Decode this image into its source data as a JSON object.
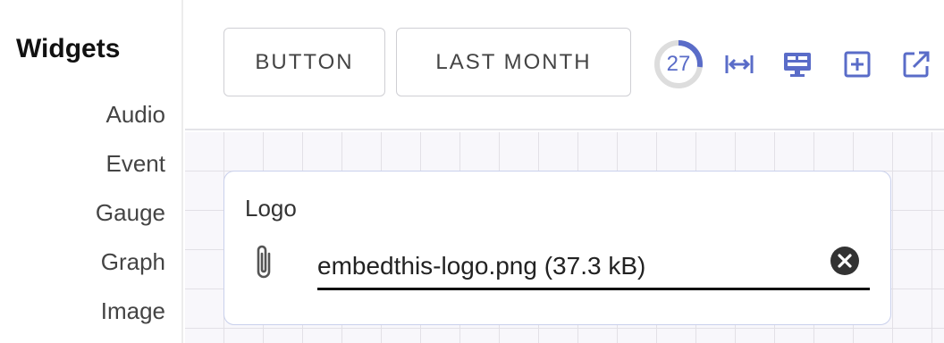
{
  "sidebar": {
    "title": "Widgets",
    "items": [
      {
        "label": "Audio"
      },
      {
        "label": "Event"
      },
      {
        "label": "Gauge"
      },
      {
        "label": "Graph"
      },
      {
        "label": "Image"
      }
    ]
  },
  "toolbar": {
    "button_label": "BUTTON",
    "range_label": "LAST MONTH",
    "gauge": {
      "value": "27",
      "fraction": 0.27
    },
    "icons": [
      "fit-width-icon",
      "display-icon",
      "add-box-icon",
      "open-external-icon"
    ]
  },
  "widget": {
    "label": "Logo",
    "file_value": "embedthis-logo.png (37.3 kB)",
    "icon": "paperclip-icon",
    "clear_icon": "clear-icon"
  },
  "colors": {
    "accent": "#5a6cc8",
    "grid_background": "#f8f7fb",
    "card_border": "#c9d0ec"
  }
}
